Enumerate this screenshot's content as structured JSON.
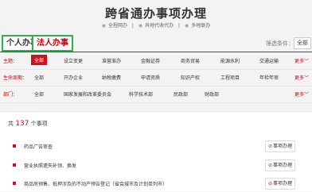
{
  "header": {
    "title": "跨省通办事项办理",
    "subtitles": [
      "全程网办",
      "异地代收代办",
      "多地联办"
    ]
  },
  "tabs": [
    {
      "label": "个人办事"
    },
    {
      "label": "法人办事"
    }
  ],
  "screen": {
    "label": "筛选条件：",
    "all_button": "全部"
  },
  "filters": [
    {
      "label": "主题：",
      "options": [
        "全部",
        "设立变更",
        "准营准办",
        "金融证券",
        "商务贸易",
        "能源水利",
        "交通运输"
      ],
      "active": "全部",
      "more": "更多"
    },
    {
      "label": "生命周期：",
      "options": [
        "全部",
        "开办企业",
        "纳税缴费",
        "申请资质",
        "知识产权",
        "工程项目",
        "年检年审"
      ],
      "more": "更多"
    },
    {
      "label": "部门：",
      "options": [
        "全部",
        "国家发展和改革委员会",
        "科学技术部",
        "民政部",
        "财政部"
      ],
      "more": "更多"
    }
  ],
  "results": {
    "prefix": "共",
    "count": "137",
    "suffix": "个事项",
    "items": [
      {
        "name": "药品广告审查",
        "guide": "事项办理"
      },
      {
        "name": "营业执照遗失补领、换发",
        "guide": "事项办理"
      },
      {
        "name": "商品房预售、抵押涉及的不动产预告登记（省会城市及计划单列市）",
        "guide": "事项办理"
      }
    ]
  },
  "colors": {
    "accent": "#d0101a",
    "tab_border": "#2bb34a"
  }
}
